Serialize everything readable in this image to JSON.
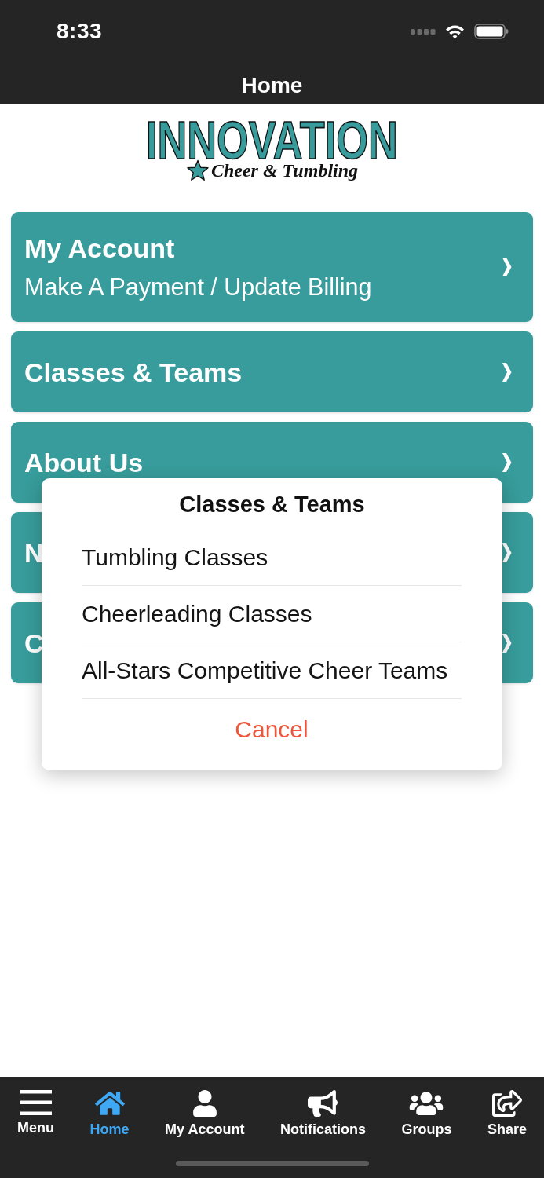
{
  "status_bar": {
    "time": "8:33"
  },
  "nav_bar": {
    "title": "Home"
  },
  "logo": {
    "wordmark": "INNOVATION",
    "tagline": "Cheer & Tumbling"
  },
  "menu_cards": [
    {
      "title": "My Account",
      "subtitle": "Make A Payment / Update Billing"
    },
    {
      "title": "Classes & Teams"
    },
    {
      "title": "About Us"
    },
    {
      "title": "N"
    },
    {
      "title": "C"
    }
  ],
  "action_sheet": {
    "title": "Classes & Teams",
    "options": [
      {
        "label": "Tumbling Classes",
        "kind": "option"
      },
      {
        "label": "Cheerleading Classes",
        "kind": "option"
      },
      {
        "label": "All-Stars Competitive Cheer Teams",
        "kind": "option"
      },
      {
        "label": "Cancel",
        "kind": "cancel"
      }
    ]
  },
  "tab_bar": {
    "tabs": [
      {
        "label": "Menu",
        "selected": false
      },
      {
        "label": "Home",
        "selected": true
      },
      {
        "label": "My Account",
        "selected": false
      },
      {
        "label": "Notifications",
        "selected": false
      },
      {
        "label": "Groups",
        "selected": false
      },
      {
        "label": "Share",
        "selected": false
      }
    ]
  }
}
